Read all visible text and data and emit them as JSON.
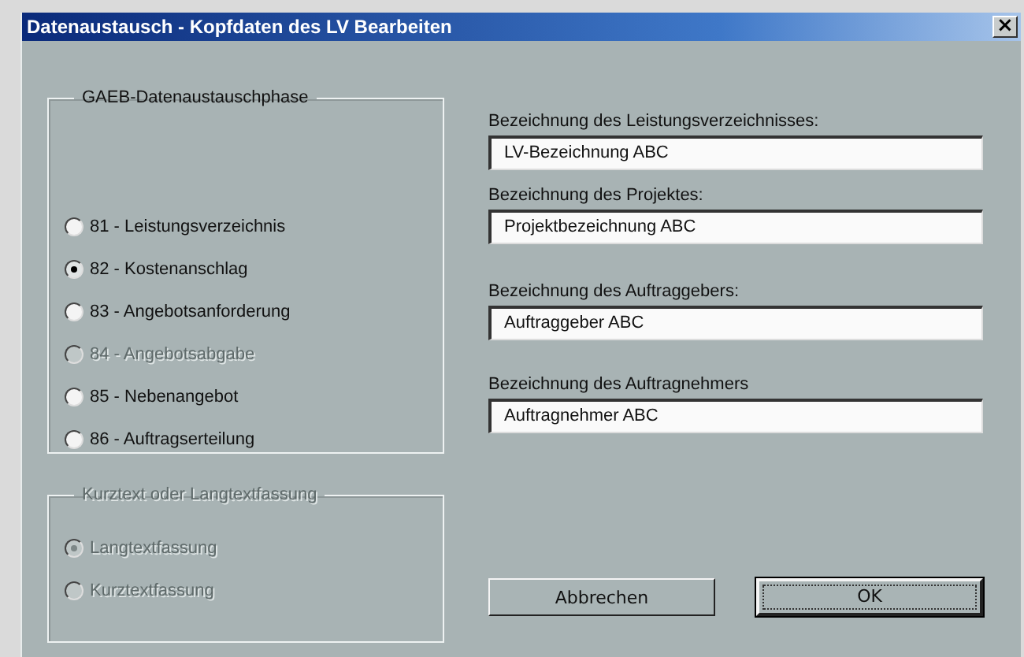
{
  "window": {
    "title": "Datenaustausch - Kopfdaten des LV Bearbeiten",
    "close": "×"
  },
  "phase_group": {
    "title": "GAEB-Datenaustauschphase",
    "disabled": false,
    "options": [
      {
        "label": "81 - Leistungsverzeichnis",
        "selected": false,
        "disabled": false
      },
      {
        "label": "82 - Kostenanschlag",
        "selected": true,
        "disabled": false
      },
      {
        "label": "83 - Angebotsanforderung",
        "selected": false,
        "disabled": false
      },
      {
        "label": "84 - Angebotsabgabe",
        "selected": false,
        "disabled": true
      },
      {
        "label": "85 - Nebenangebot",
        "selected": false,
        "disabled": false
      },
      {
        "label": "86 - Auftragserteilung",
        "selected": false,
        "disabled": false
      }
    ]
  },
  "text_group": {
    "title": "Kurztext oder Langtextfassung",
    "disabled": true,
    "options": [
      {
        "label": "Langtextfassung",
        "selected": true,
        "disabled": true
      },
      {
        "label": "Kurztextfassung",
        "selected": false,
        "disabled": true
      }
    ]
  },
  "fields": [
    {
      "label": "Bezeichnung des Leistungsverzeichnisses:",
      "value": "LV-Bezeichnung ABC"
    },
    {
      "label": "Bezeichnung des Projektes:",
      "value": "Projektbezeichnung ABC"
    },
    {
      "label": "Bezeichnung des Auftraggebers:",
      "value": "Auftraggeber ABC"
    },
    {
      "label": "Bezeichnung des Auftragnehmers",
      "value": "Auftragnehmer ABC"
    }
  ],
  "buttons": [
    {
      "label": "Abbrechen",
      "default": false
    },
    {
      "label": "OK",
      "default": true
    }
  ]
}
